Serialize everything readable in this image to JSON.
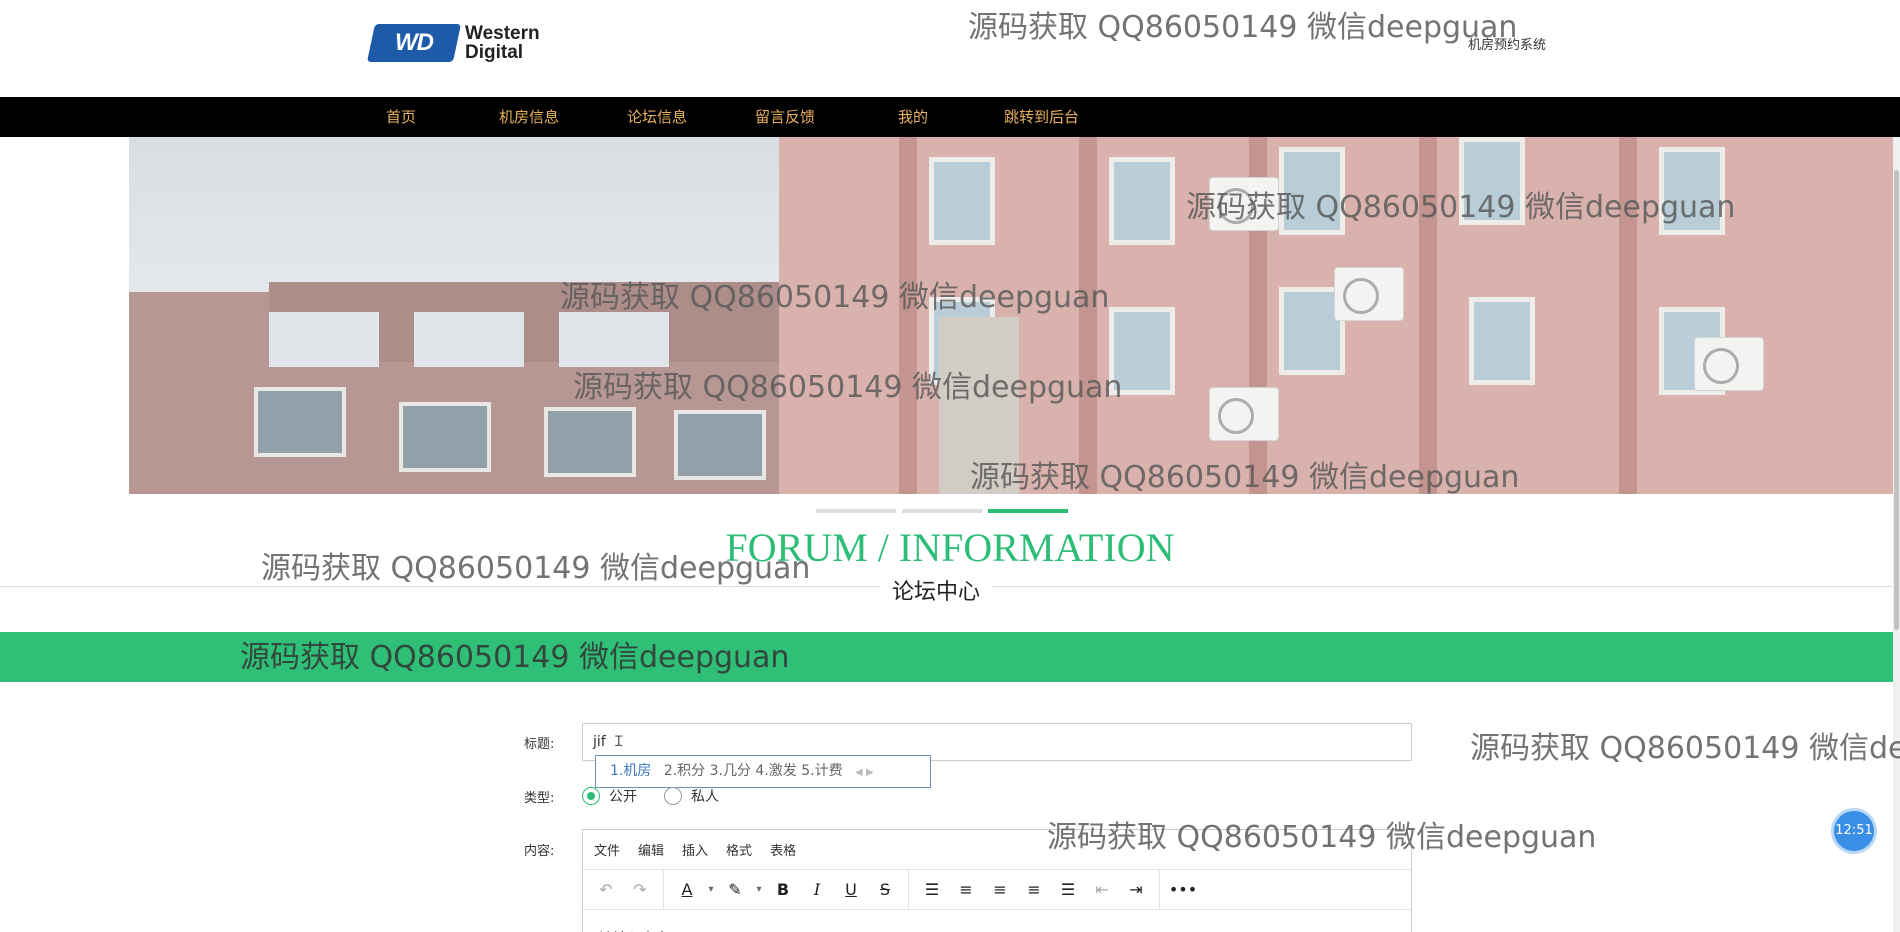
{
  "header": {
    "logo_line1": "Western",
    "logo_line2": "Digital",
    "logo_mark": "WD",
    "system_name": "机房预约系统"
  },
  "nav": {
    "items": [
      "首页",
      "机房信息",
      "论坛信息",
      "留言反馈",
      "我的",
      "跳转到后台"
    ]
  },
  "banner": {
    "slides_count": 3,
    "active_slide": 3
  },
  "section": {
    "title_en": "FORUM / INFORMATION",
    "title_cn": "论坛中心"
  },
  "form": {
    "title_label": "标题:",
    "title_value": "jif",
    "ime_candidates": "1.机房  2.积分  3.几分  4.激发  5.计费",
    "ime_first": "1.机房",
    "ime_rest": "2.积分  3.几分  4.激发  5.计费",
    "type_label": "类型:",
    "type_options": [
      "公开",
      "私人"
    ],
    "type_selected": "公开",
    "content_label": "内容:",
    "editor_menus": [
      "文件",
      "编辑",
      "插入",
      "格式",
      "表格"
    ],
    "editor_placeholder": "请输入内容"
  },
  "clock": "12:51",
  "watermark": "源码获取 QQ86050149 微信deepguan",
  "watermark_cut": "源码获取 QQ86050149 微信de",
  "colors": {
    "accent": "#2dbd77",
    "nav_bg": "#000000",
    "nav_text": "#e8b15e"
  }
}
